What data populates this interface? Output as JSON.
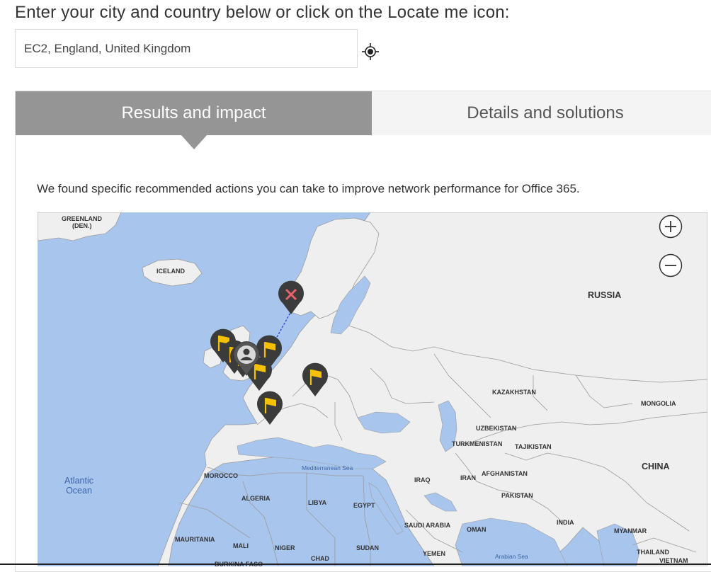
{
  "header": {
    "prompt": "Enter your city and country below or click on the Locate me icon:"
  },
  "location": {
    "value": "EC2, England, United Kingdom",
    "locate_icon": "crosshair-target-icon"
  },
  "tabs": [
    {
      "label": "Results and impact",
      "active": true
    },
    {
      "label": "Details and solutions",
      "active": false
    }
  ],
  "summary": "We found specific recommended actions you can take to improve network performance for Office 365.",
  "map": {
    "labels": {
      "greenland": "GREENLAND",
      "greenland_sub": "(DEN.)",
      "iceland": "ICELAND",
      "russia": "RUSSIA",
      "kazakhstan": "KAZAKHSTAN",
      "mongolia": "MONGOLIA",
      "uzbekistan": "UZBEKISTAN",
      "turkmenistan": "TURKMENISTAN",
      "tajikistan": "TAJIKISTAN",
      "china": "CHINA",
      "atlantic_1": "Atlantic",
      "atlantic_2": "Ocean",
      "morocco": "MOROCCO",
      "mediterranean": "Mediterranean Sea",
      "iraq": "IRAQ",
      "iran": "IRAN",
      "afghanistan": "AFGHANISTAN",
      "pakistan": "PAKISTAN",
      "algeria": "ALGERIA",
      "libya": "LIBYA",
      "egypt": "EGYPT",
      "saudi_arabia": "SAUDI ARABIA",
      "oman": "OMAN",
      "india": "INDIA",
      "myanmar": "MYANMAR",
      "mauritania": "MAURITANIA",
      "mali": "MALI",
      "niger": "NIGER",
      "sudan": "SUDAN",
      "yemen": "YEMEN",
      "chad": "CHAD",
      "burkina_faso": "BURKINA FASO",
      "arabian_sea": "Arabian Sea",
      "thailand": "THAILAND",
      "vietnam": "VIETNAM"
    },
    "zoom_in_icon": "plus-circle-icon",
    "zoom_out_icon": "minus-circle-icon",
    "pins": [
      {
        "type": "error",
        "icon": "x-pin-icon"
      },
      {
        "type": "user",
        "icon": "person-pin-icon"
      },
      {
        "type": "flag",
        "icon": "flag-pin-icon"
      }
    ],
    "colors": {
      "water": "#a8c6ed",
      "land": "#efefef",
      "border": "#9b9b9b",
      "pin": "#3b3b3b",
      "flag": "#f5c000",
      "error_x": "#e8616a",
      "route": "#2b3fd6"
    }
  }
}
